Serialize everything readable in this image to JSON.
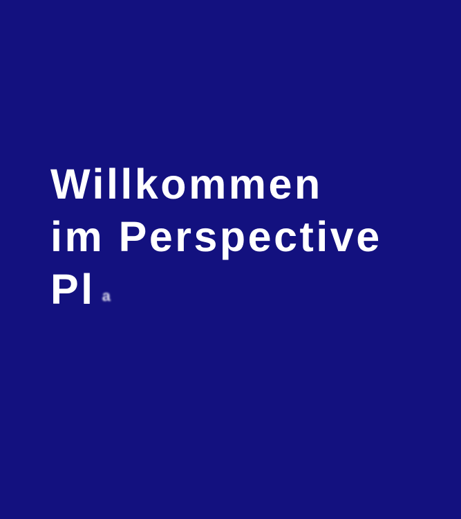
{
  "colors": {
    "background": "#13117F",
    "text": "#FFFFFF"
  },
  "headline": {
    "line1": "Willkommen",
    "line2": "im Perspective",
    "line3": "Pl",
    "line3_partial": "a"
  }
}
